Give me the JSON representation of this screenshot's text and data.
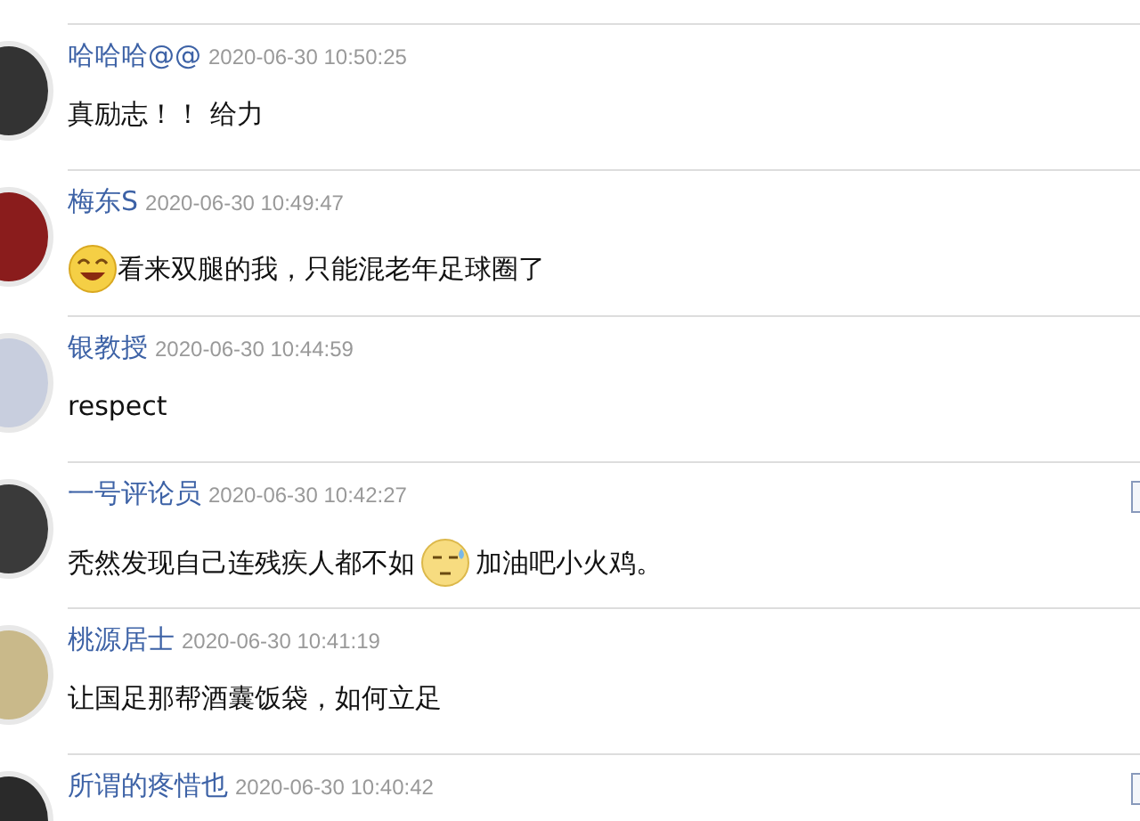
{
  "comments": [
    {
      "author": "哈哈哈@@",
      "time": "2020-06-30 10:50:25",
      "body": [
        {
          "kind": "text",
          "text": "真励志！！ 给力"
        }
      ],
      "flagged": false
    },
    {
      "author": "梅东S",
      "time": "2020-06-30 10:49:47",
      "body": [
        {
          "kind": "laugh_emoji"
        },
        {
          "kind": "text",
          "text": "看来双腿的我，只能混老年足球圈了"
        }
      ],
      "flagged": false
    },
    {
      "author": "银教授",
      "time": "2020-06-30 10:44:59",
      "body": [
        {
          "kind": "text",
          "text": "respect"
        }
      ],
      "flagged": false
    },
    {
      "author": "一号评论员",
      "time": "2020-06-30 10:42:27",
      "body": [
        {
          "kind": "text",
          "text": "秃然发现自己连残疾人都不如"
        },
        {
          "kind": "sweat_emoji"
        },
        {
          "kind": "text",
          "text": "加油吧小火鸡。"
        }
      ],
      "flagged": true
    },
    {
      "author": "桃源居士",
      "time": "2020-06-30 10:41:19",
      "body": [
        {
          "kind": "text",
          "text": "让国足那帮酒囊饭袋，如何立足"
        }
      ],
      "flagged": false
    },
    {
      "author": "所谓的疼惜也",
      "time": "2020-06-30 10:40:42",
      "flagged": true
    }
  ]
}
